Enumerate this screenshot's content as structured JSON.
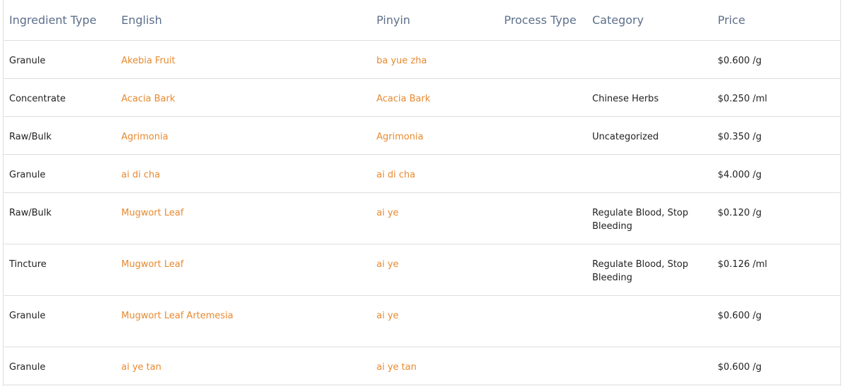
{
  "headers": {
    "ingredient_type": "Ingredient Type",
    "english": "English",
    "pinyin": "Pinyin",
    "process_type": "Process Type",
    "category": "Category",
    "price": "Price"
  },
  "rows": [
    {
      "type": "Granule",
      "english": "Akebia Fruit",
      "pinyin": "ba yue zha",
      "process": "",
      "category": "",
      "price": "$0.600 /g"
    },
    {
      "type": "Concentrate",
      "english": "Acacia Bark",
      "pinyin": "Acacia Bark",
      "process": "",
      "category": "Chinese Herbs",
      "price": "$0.250 /ml"
    },
    {
      "type": "Raw/Bulk",
      "english": "Agrimonia",
      "pinyin": "Agrimonia",
      "process": "",
      "category": "Uncategorized",
      "price": "$0.350 /g"
    },
    {
      "type": "Granule",
      "english": "ai di cha",
      "pinyin": "ai di cha",
      "process": "",
      "category": "",
      "price": "$4.000 /g"
    },
    {
      "type": "Raw/Bulk",
      "english": "Mugwort Leaf",
      "pinyin": "ai ye",
      "process": "",
      "category": "Regulate Blood, Stop Bleeding",
      "price": "$0.120 /g"
    },
    {
      "type": "Tincture",
      "english": "Mugwort Leaf",
      "pinyin": "ai ye",
      "process": "",
      "category": "Regulate Blood, Stop Bleeding",
      "price": "$0.126 /ml"
    },
    {
      "type": "Granule",
      "english": "Mugwort Leaf Artemesia",
      "pinyin": "ai ye",
      "process": "",
      "category": "",
      "price": "$0.600 /g"
    },
    {
      "type": "Granule",
      "english": "ai ye tan",
      "pinyin": "ai ye tan",
      "process": "",
      "category": "",
      "price": "$0.600 /g"
    }
  ]
}
